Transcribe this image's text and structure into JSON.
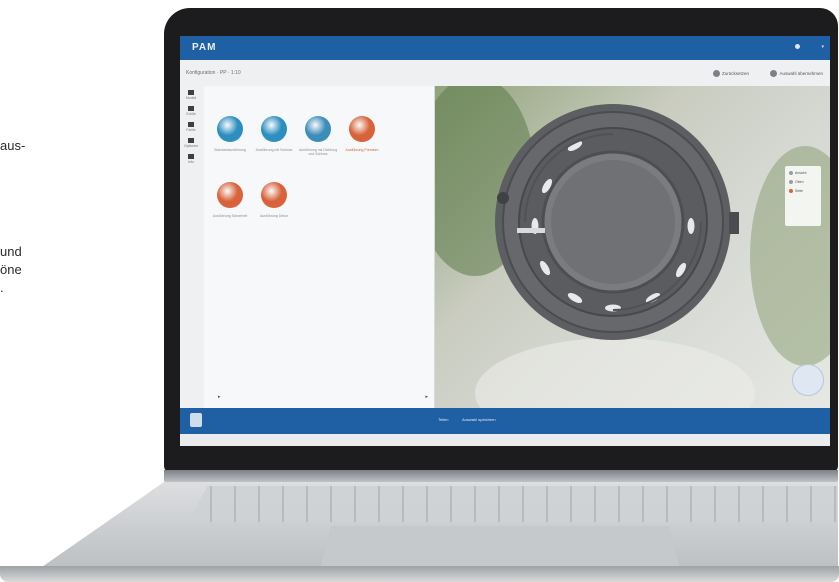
{
  "side_text": [
    {
      "text": "aus-"
    },
    {
      "text": "und"
    },
    {
      "text": "öne"
    },
    {
      "text": "."
    }
  ],
  "app": {
    "logo": "PAM",
    "breadcrumb": "Konfiguration · PP · 1:10",
    "toolbar": [
      {
        "label": "Zurücksetzen",
        "icon": "reset-icon"
      },
      {
        "label": "Auswahl übernehmen",
        "icon": "apply-icon"
      }
    ],
    "rail": [
      {
        "label": "Modell",
        "icon": "model-icon"
      },
      {
        "label": "Größe",
        "icon": "size-icon"
      },
      {
        "label": "Farbe",
        "icon": "color-icon"
      },
      {
        "label": "Optionen",
        "icon": "options-icon"
      },
      {
        "label": "Info",
        "icon": "info-icon"
      }
    ],
    "catalog": [
      {
        "label": "Standardausführung",
        "color": "#2d8fc0",
        "selected": false
      },
      {
        "label": "Ausführung mit Schloss",
        "color": "#2d8fc0",
        "selected": false
      },
      {
        "label": "Ausführung mit Dichtung und Schloss",
        "color": "#3d8dbb",
        "selected": false
      },
      {
        "label": "Ausführung Premium",
        "color": "#d8623a",
        "selected": true
      },
      {
        "label": "Ausführung Sicherheit",
        "color": "#d8623a",
        "selected": false
      },
      {
        "label": "Ausführung Dekor",
        "color": "#d8623a",
        "selected": false
      }
    ],
    "view_panel": [
      {
        "label": "Ansicht",
        "on": false
      },
      {
        "label": "Oben",
        "on": false
      },
      {
        "label": "Seite",
        "on": true
      }
    ],
    "bottom_tabs": [
      {
        "label": "Teilen"
      },
      {
        "label": "Auswahl speichern"
      }
    ]
  },
  "colors": {
    "brand_blue": "#1f5fa3",
    "accent_orange": "#d8623a",
    "disc_blue": "#2d8fc0"
  }
}
